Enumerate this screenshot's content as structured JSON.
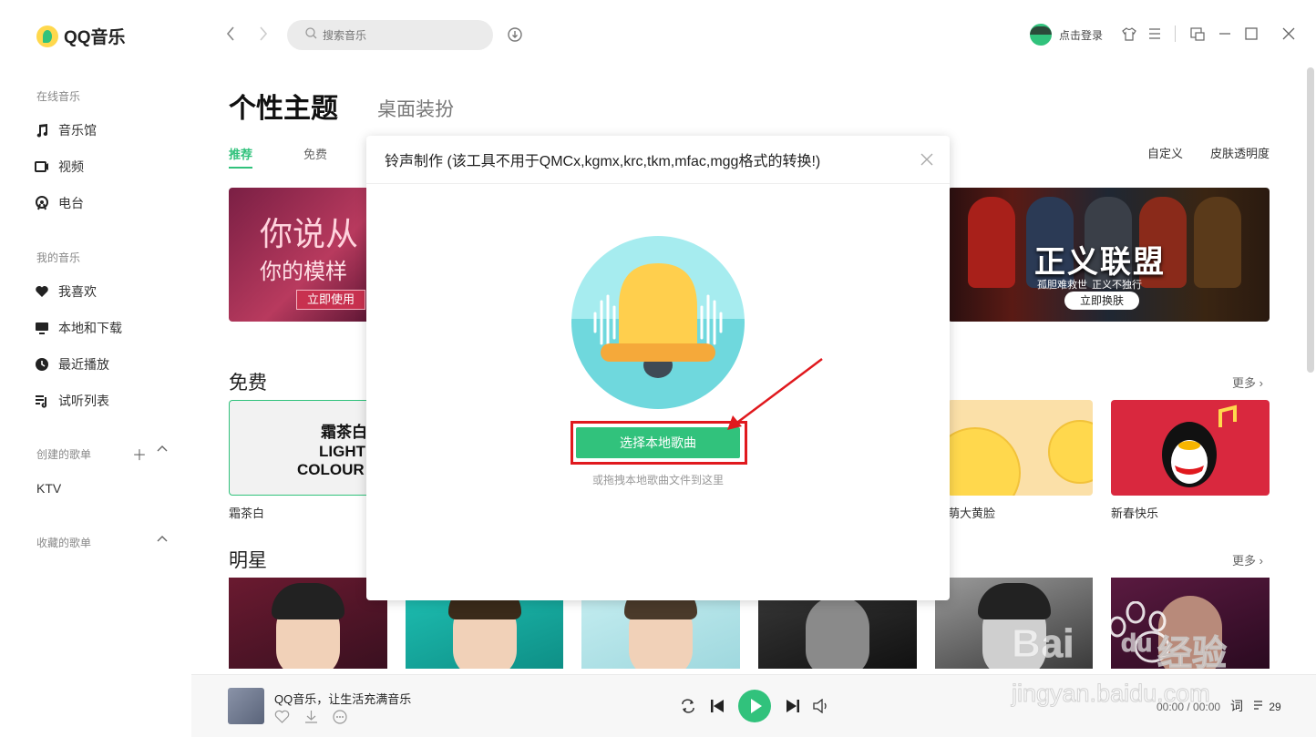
{
  "app": {
    "logo_text": "QQ音乐",
    "accent": "#31c27c"
  },
  "search": {
    "placeholder": "搜索音乐"
  },
  "header": {
    "login": "点击登录"
  },
  "sidebar": {
    "online_section": "在线音乐",
    "online_items": [
      "音乐馆",
      "视频",
      "电台"
    ],
    "my_section": "我的音乐",
    "my_items": [
      "我喜欢",
      "本地和下载",
      "最近播放",
      "试听列表"
    ],
    "created_section": "创建的歌单",
    "created_items": [
      "KTV"
    ],
    "collected_section": "收藏的歌单"
  },
  "page": {
    "title": "个性主题",
    "subtitle": "桌面装扮",
    "tabs": [
      "推荐",
      "免费"
    ],
    "links": [
      "自定义",
      "皮肤透明度"
    ]
  },
  "banners": {
    "left": {
      "line1": "你说从",
      "line2": "你的模样",
      "button": "立即使用"
    },
    "right": {
      "title": "正义联盟",
      "sub1": "孤胆难救世",
      "sub2": "正义不独行",
      "button": "立即换肤"
    }
  },
  "free_section": {
    "title": "免费",
    "more": "更多",
    "card1": {
      "t1": "霜茶白",
      "t2": "LIGHT",
      "t3": "COLOUR"
    },
    "labels": [
      "霜茶白",
      "萌大黄脸",
      "新春快乐"
    ]
  },
  "star_section": {
    "title": "明星",
    "more": "更多"
  },
  "dialog": {
    "title": "铃声制作 (该工具不用于QMCx,kgmx,krc,tkm,mfac,mgg格式的转换!)",
    "button": "选择本地歌曲",
    "hint": "或拖拽本地歌曲文件到这里"
  },
  "player": {
    "song": "QQ音乐，让生活充满音乐",
    "time": "00:00 / 00:00",
    "lyric": "词",
    "playlist_count": "29"
  },
  "watermark": {
    "brand": "Bai",
    "brand2": "du",
    "cn": "经验",
    "url": "jingyan.baidu.com"
  }
}
